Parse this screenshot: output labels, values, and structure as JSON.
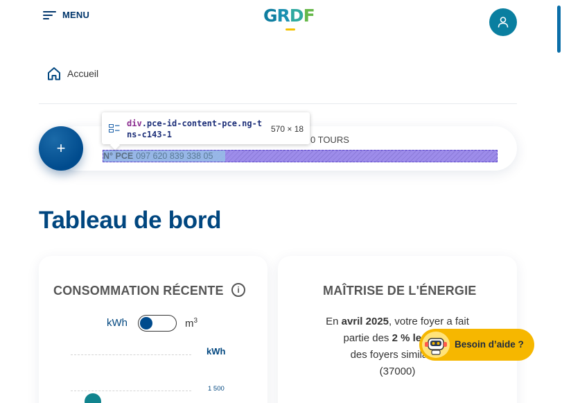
{
  "header": {
    "menu_label": "MENU",
    "logo": {
      "g": "G",
      "r": "R",
      "d": "D",
      "f": "F"
    }
  },
  "breadcrumb": {
    "home_label": "Accueil"
  },
  "pce": {
    "address_suffix": "0 TOURS",
    "prefix": "N° PCE",
    "number": "097 620 839 338 05"
  },
  "devtools_tooltip": {
    "tag": "div",
    "selector": ".pce-id-content-pce.ng-tns-c143-1",
    "size": "570 × 18"
  },
  "page": {
    "title": "Tableau de bord"
  },
  "consumption_card": {
    "title": "CONSOMMATION RÉCENTE",
    "info_icon": "i",
    "unit_kwh": "kWh",
    "unit_m3": "m",
    "unit_m3_sup": "3",
    "toggle_state": "kWh",
    "axis_unit": "kWh",
    "axis_tick": "1 500"
  },
  "energy_card": {
    "title": "MAÎTRISE DE L'ÉNERGIE",
    "line1_pre": "En ",
    "line1_bold": "avril 2025",
    "line1_post": ", votre foyer a fait",
    "line2_pre": "partie des ",
    "line2_bold": "2 % les plus",
    "line3": "des foyers similaires",
    "line4": "(37000)"
  },
  "help": {
    "label": "Besoin d’aide ?"
  },
  "colors": {
    "primary": "#00467f",
    "accent": "#0a7fa0",
    "help_bg": "#f6b700",
    "teal_point": "#11848e"
  }
}
